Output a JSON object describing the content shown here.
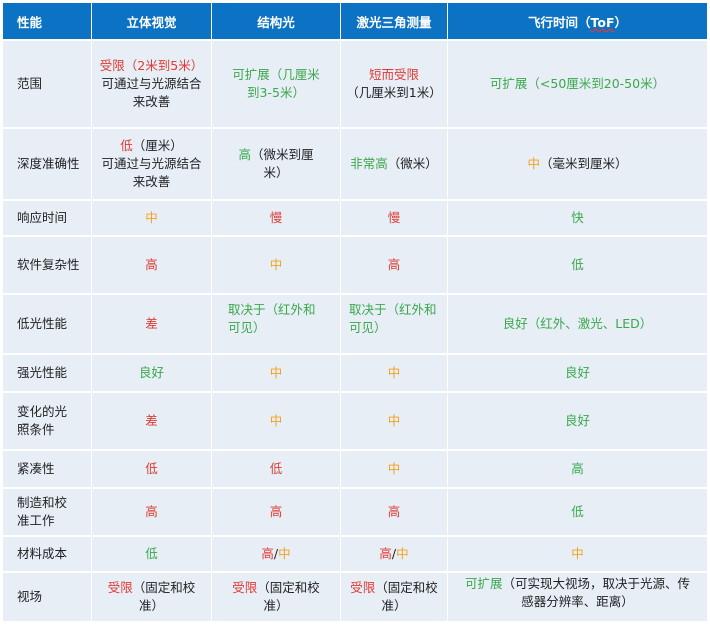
{
  "header": {
    "col0": "性能",
    "col1": "立体视觉",
    "col2": "结构光",
    "col3": "激光三角测量",
    "col4_prefix": "飞行时间（",
    "col4_tof": "ToF",
    "col4_suffix": "）"
  },
  "rows": [
    {
      "label": "范围",
      "c1_colored": "受限（2米到5米）",
      "c1_note": "可通过与光源结合来改善",
      "c2": "可扩展（几厘米到3-5米）",
      "c3_colored": "短而受限",
      "c3_note": "（几厘米到1米）",
      "c4": "可扩展（<50厘米到20-50米）"
    },
    {
      "label": "深度准确性",
      "c1_colored": "低",
      "c1_rest": "（厘米）",
      "c1_note": "可通过与光源结合来改善",
      "c2_colored": "高",
      "c2_rest": "（微米到厘米）",
      "c3_colored": "非常高",
      "c3_rest": "（微米）",
      "c4_colored": "中",
      "c4_rest": "（毫米到厘米）"
    },
    {
      "label": "响应时间",
      "c1": "中",
      "c2": "慢",
      "c3": "慢",
      "c4": "快"
    },
    {
      "label": "软件复杂性",
      "c1": "高",
      "c2": "中",
      "c3": "高",
      "c4": "低"
    },
    {
      "label": "低光性能",
      "c1": "差",
      "c2": "取决于（红外和可见）",
      "c3": "取决于（红外和可见）",
      "c4": "良好（红外、激光、LED）"
    },
    {
      "label": "强光性能",
      "c1": "良好",
      "c2": "中",
      "c3": "中",
      "c4": "良好"
    },
    {
      "label": "变化的光照条件",
      "c1": "差",
      "c2": "中",
      "c3": "中",
      "c4": "良好"
    },
    {
      "label": "紧凑性",
      "c1": "低",
      "c2": "低",
      "c3": "中",
      "c4": "高"
    },
    {
      "label": "制造和校准工作",
      "c1": "高",
      "c2": "高",
      "c3": "高",
      "c4": "低"
    },
    {
      "label": "材料成本",
      "c1": "低",
      "c2_a": "高",
      "c2_sep": "/",
      "c2_b": "中",
      "c3_a": "高",
      "c3_sep": "/",
      "c3_b": "中",
      "c4": "中"
    },
    {
      "label": "视场",
      "c1_colored": "受限",
      "c1_rest": "（固定和校准）",
      "c2_colored": "受限",
      "c2_rest": "（固定和校准）",
      "c3_colored": "受限",
      "c3_rest": "（固定和校准）",
      "c4_colored": "可扩展",
      "c4_rest": "（可实现大视场，取决于光源、传感器分辨率、距离）"
    }
  ],
  "colors": {
    "header_bg": "#0b72c4",
    "cell_bg": "#e7eef6",
    "red": "#e03a32",
    "green": "#3aa84c",
    "orange": "#f4a21c"
  }
}
